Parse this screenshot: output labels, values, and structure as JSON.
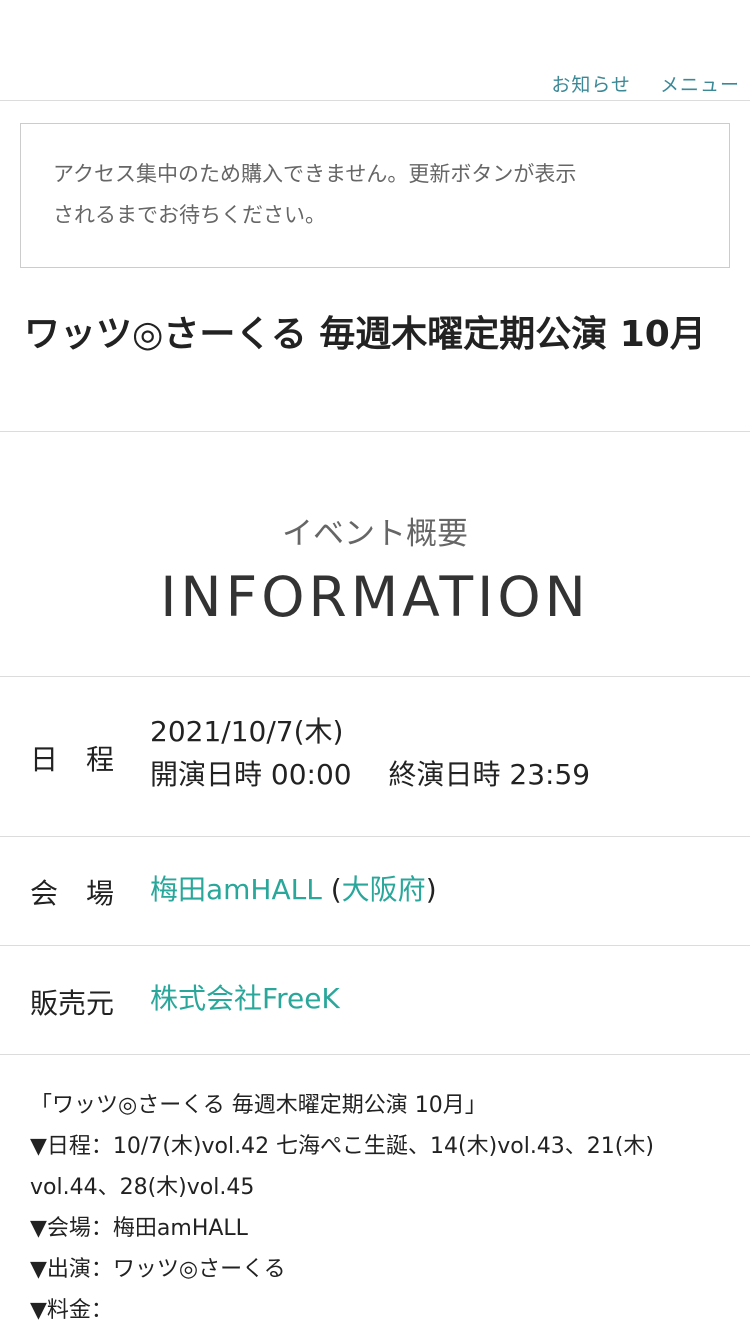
{
  "nav": {
    "news": "お知らせ",
    "menu": "メニュー"
  },
  "notice": {
    "line1": "アクセス集中のため購入できません。更新ボタンが表示",
    "line2": "されるまでお待ちください。"
  },
  "event": {
    "title": "ワッツ◎さーくる 毎週木曜定期公演 10月"
  },
  "info": {
    "subtitle": "イベント概要",
    "heading": "INFORMATION"
  },
  "schedule": {
    "label": "日　程",
    "date": "2021/10/7(木)",
    "times": "開演日時 00:00　 終演日時 23:59"
  },
  "venue": {
    "label": "会　場",
    "name": "梅田amHALL",
    "open_paren": " (",
    "prefecture": "大阪府",
    "close_paren": ")"
  },
  "seller": {
    "label": "販売元",
    "name": "株式会社FreeK"
  },
  "description": {
    "lines": [
      "「ワッツ◎さーくる 毎週木曜定期公演 10月」",
      "▼日程：10/7(木)vol.42 七海ぺこ生誕、14(木)vol.43、21(木)",
      "vol.44、28(木)vol.45",
      "▼会場：梅田amHALL",
      "▼出演：ワッツ◎さーくる",
      "▼料金："
    ]
  },
  "colors": {
    "link": "#2aa79b",
    "nav_link": "#3b8897"
  }
}
